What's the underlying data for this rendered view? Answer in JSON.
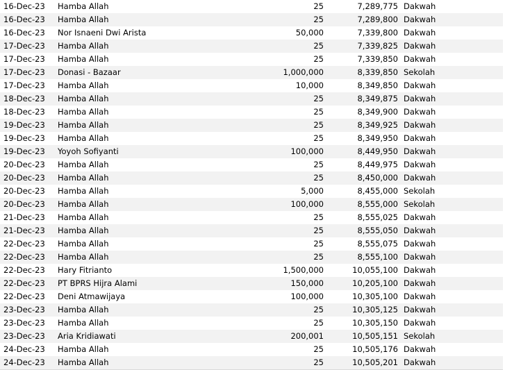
{
  "rows": [
    {
      "date": "16-Dec-23",
      "name": "Hamba Allah",
      "amount": "25",
      "balance": "7,289,775",
      "category": "Dakwah"
    },
    {
      "date": "16-Dec-23",
      "name": "Hamba Allah",
      "amount": "25",
      "balance": "7,289,800",
      "category": "Dakwah"
    },
    {
      "date": "16-Dec-23",
      "name": "Nor Isnaeni Dwi Arista",
      "amount": "50,000",
      "balance": "7,339,800",
      "category": "Dakwah"
    },
    {
      "date": "17-Dec-23",
      "name": "Hamba Allah",
      "amount": "25",
      "balance": "7,339,825",
      "category": "Dakwah"
    },
    {
      "date": "17-Dec-23",
      "name": "Hamba Allah",
      "amount": "25",
      "balance": "7,339,850",
      "category": "Dakwah"
    },
    {
      "date": "17-Dec-23",
      "name": "Donasi - Bazaar",
      "amount": "1,000,000",
      "balance": "8,339,850",
      "category": "Sekolah"
    },
    {
      "date": "17-Dec-23",
      "name": "Hamba Allah",
      "amount": "10,000",
      "balance": "8,349,850",
      "category": "Dakwah"
    },
    {
      "date": "18-Dec-23",
      "name": "Hamba Allah",
      "amount": "25",
      "balance": "8,349,875",
      "category": "Dakwah"
    },
    {
      "date": "18-Dec-23",
      "name": "Hamba Allah",
      "amount": "25",
      "balance": "8,349,900",
      "category": "Dakwah"
    },
    {
      "date": "19-Dec-23",
      "name": "Hamba Allah",
      "amount": "25",
      "balance": "8,349,925",
      "category": "Dakwah"
    },
    {
      "date": "19-Dec-23",
      "name": "Hamba Allah",
      "amount": "25",
      "balance": "8,349,950",
      "category": "Dakwah"
    },
    {
      "date": "19-Dec-23",
      "name": "Yoyoh Sofiyanti",
      "amount": "100,000",
      "balance": "8,449,950",
      "category": "Dakwah"
    },
    {
      "date": "20-Dec-23",
      "name": "Hamba Allah",
      "amount": "25",
      "balance": "8,449,975",
      "category": "Dakwah"
    },
    {
      "date": "20-Dec-23",
      "name": "Hamba Allah",
      "amount": "25",
      "balance": "8,450,000",
      "category": "Dakwah"
    },
    {
      "date": "20-Dec-23",
      "name": "Hamba Allah",
      "amount": "5,000",
      "balance": "8,455,000",
      "category": "Sekolah"
    },
    {
      "date": "20-Dec-23",
      "name": "Hamba Allah",
      "amount": "100,000",
      "balance": "8,555,000",
      "category": "Sekolah"
    },
    {
      "date": "21-Dec-23",
      "name": "Hamba Allah",
      "amount": "25",
      "balance": "8,555,025",
      "category": "Dakwah"
    },
    {
      "date": "21-Dec-23",
      "name": "Hamba Allah",
      "amount": "25",
      "balance": "8,555,050",
      "category": "Dakwah"
    },
    {
      "date": "22-Dec-23",
      "name": "Hamba Allah",
      "amount": "25",
      "balance": "8,555,075",
      "category": "Dakwah"
    },
    {
      "date": "22-Dec-23",
      "name": "Hamba Allah",
      "amount": "25",
      "balance": "8,555,100",
      "category": "Dakwah"
    },
    {
      "date": "22-Dec-23",
      "name": "Hary Fitrianto",
      "amount": "1,500,000",
      "balance": "10,055,100",
      "category": "Dakwah"
    },
    {
      "date": "22-Dec-23",
      "name": "PT BPRS Hijra Alami",
      "amount": "150,000",
      "balance": "10,205,100",
      "category": "Dakwah"
    },
    {
      "date": "22-Dec-23",
      "name": "Deni Atmawijaya",
      "amount": "100,000",
      "balance": "10,305,100",
      "category": "Dakwah"
    },
    {
      "date": "23-Dec-23",
      "name": "Hamba Allah",
      "amount": "25",
      "balance": "10,305,125",
      "category": "Dakwah"
    },
    {
      "date": "23-Dec-23",
      "name": "Hamba Allah",
      "amount": "25",
      "balance": "10,305,150",
      "category": "Dakwah"
    },
    {
      "date": "23-Dec-23",
      "name": "Aria Kridiawati",
      "amount": "200,001",
      "balance": "10,505,151",
      "category": "Sekolah"
    },
    {
      "date": "24-Dec-23",
      "name": "Hamba Allah",
      "amount": "25",
      "balance": "10,505,176",
      "category": "Dakwah"
    },
    {
      "date": "24-Dec-23",
      "name": "Hamba Allah",
      "amount": "25",
      "balance": "10,505,201",
      "category": "Dakwah"
    }
  ]
}
